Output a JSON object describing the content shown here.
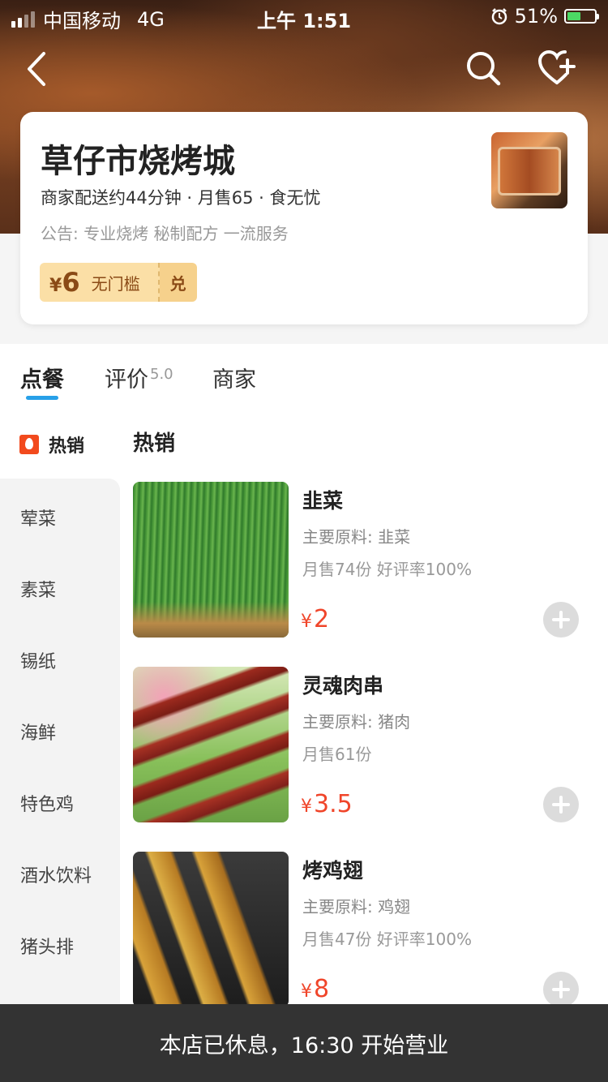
{
  "status_bar": {
    "carrier": "中国移动",
    "network": "4G",
    "time": "上午 1:51",
    "battery": "51%",
    "battery_level": 0.51,
    "icons": [
      "signal-icon",
      "alarm-icon",
      "battery-icon"
    ]
  },
  "nav": {
    "icons": [
      "back-icon",
      "search-icon",
      "favorite-add-icon"
    ]
  },
  "store": {
    "name": "草仔市烧烤城",
    "meta": "商家配送约44分钟 · 月售65 · 食无忧",
    "notice": "公告: 专业烧烤 秘制配方 一流服务",
    "coupon": {
      "currency": "¥",
      "amount": "6",
      "condition": "无门槛",
      "exchange": "兑"
    }
  },
  "tabs": [
    {
      "label": "点餐",
      "active": true
    },
    {
      "label": "评价",
      "score": "5.0"
    },
    {
      "label": "商家"
    }
  ],
  "categories": {
    "hot": "热销",
    "items": [
      "荤菜",
      "素菜",
      "锡纸",
      "海鲜",
      "特色鸡",
      "酒水饮料",
      "猪头排"
    ]
  },
  "section_title": "热销",
  "dishes": [
    {
      "name": "韭菜",
      "ingredients": "主要原料: 韭菜",
      "sales": "月售74份 好评率100%",
      "currency": "¥",
      "price": "2"
    },
    {
      "name": "灵魂肉串",
      "ingredients": "主要原料: 猪肉",
      "sales": "月售61份",
      "currency": "¥",
      "price": "3.5"
    },
    {
      "name": "烤鸡翅",
      "ingredients": "主要原料: 鸡翅",
      "sales": "月售47份 好评率100%",
      "currency": "¥",
      "price": "8"
    }
  ],
  "footer": {
    "closed_notice": "本店已休息，16:30 开始营业"
  },
  "colors": {
    "accent": "#27a0e8",
    "price": "#f0452a",
    "coupon_bg": "#fbdfa6",
    "footer_bg": "#333333"
  }
}
